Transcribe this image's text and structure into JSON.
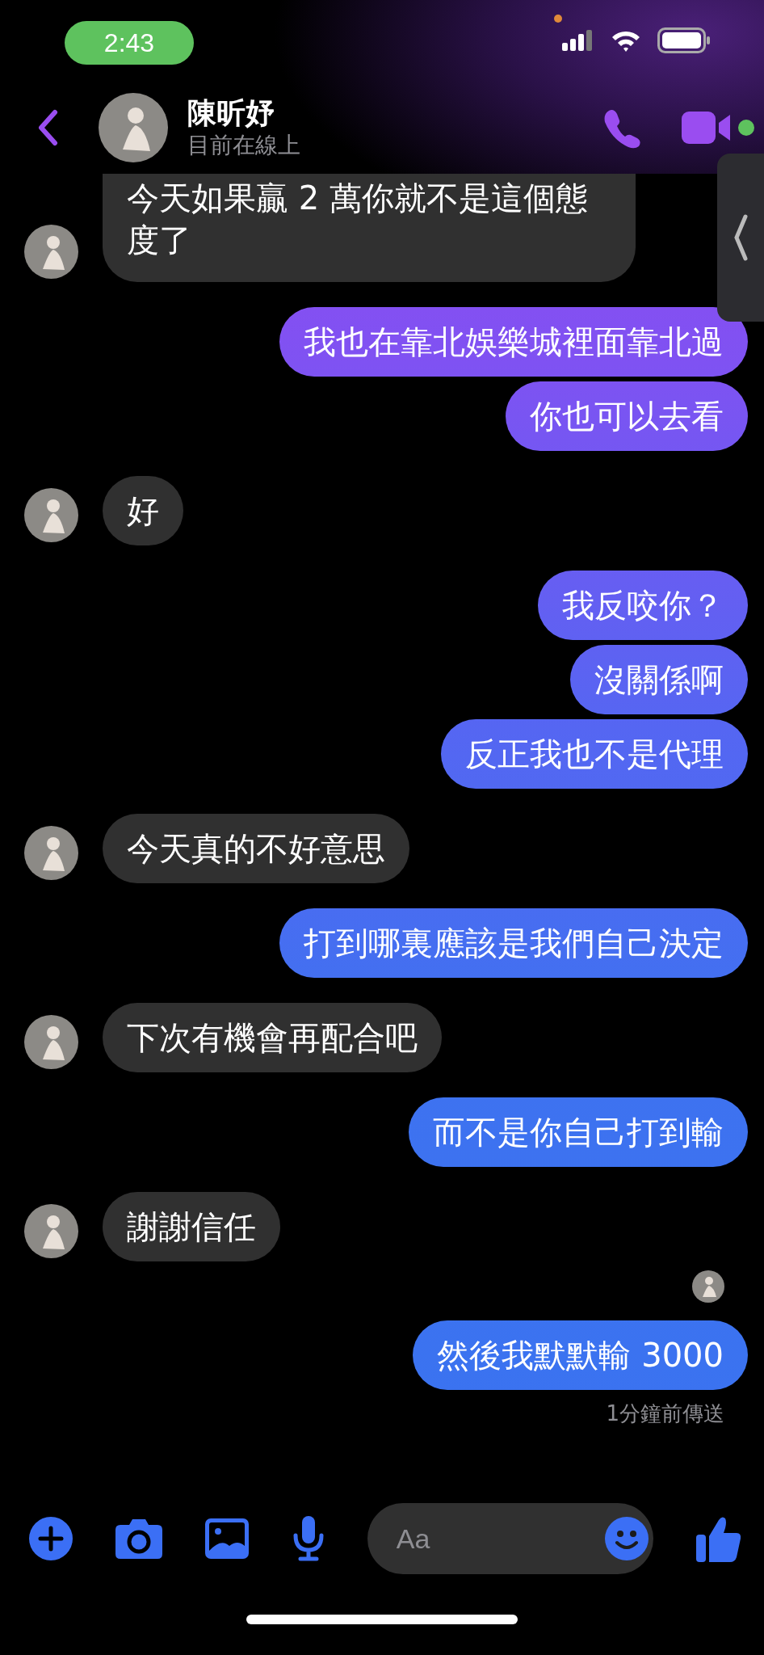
{
  "status_bar": {
    "time": "2:43"
  },
  "header": {
    "name": "陳昕妤",
    "status": "目前在線上",
    "online": true
  },
  "messages": [
    {
      "kind": "incoming",
      "text": "今天如果贏 2 萬你就不是這個態度了",
      "cut": true
    },
    {
      "kind": "outgoing",
      "text": "我也在靠北娛樂城裡面靠北過"
    },
    {
      "kind": "outgoing",
      "text": "你也可以去看"
    },
    {
      "kind": "incoming",
      "text": "好"
    },
    {
      "kind": "outgoing",
      "text": "我反咬你？"
    },
    {
      "kind": "outgoing",
      "text": "沒關係啊"
    },
    {
      "kind": "outgoing",
      "text": "反正我也不是代理"
    },
    {
      "kind": "incoming",
      "text": "今天真的不好意思"
    },
    {
      "kind": "outgoing",
      "text": "打到哪裏應該是我們自己決定"
    },
    {
      "kind": "incoming",
      "text": "下次有機會再配合吧"
    },
    {
      "kind": "outgoing",
      "text": "而不是你自己打到輸"
    },
    {
      "kind": "incoming",
      "text": "謝謝信任"
    },
    {
      "kind": "outgoing",
      "text": "然後我默默輸 3000",
      "seen": true
    }
  ],
  "receipt": "1分鐘前傳送",
  "composer": {
    "placeholder": "Aa"
  }
}
